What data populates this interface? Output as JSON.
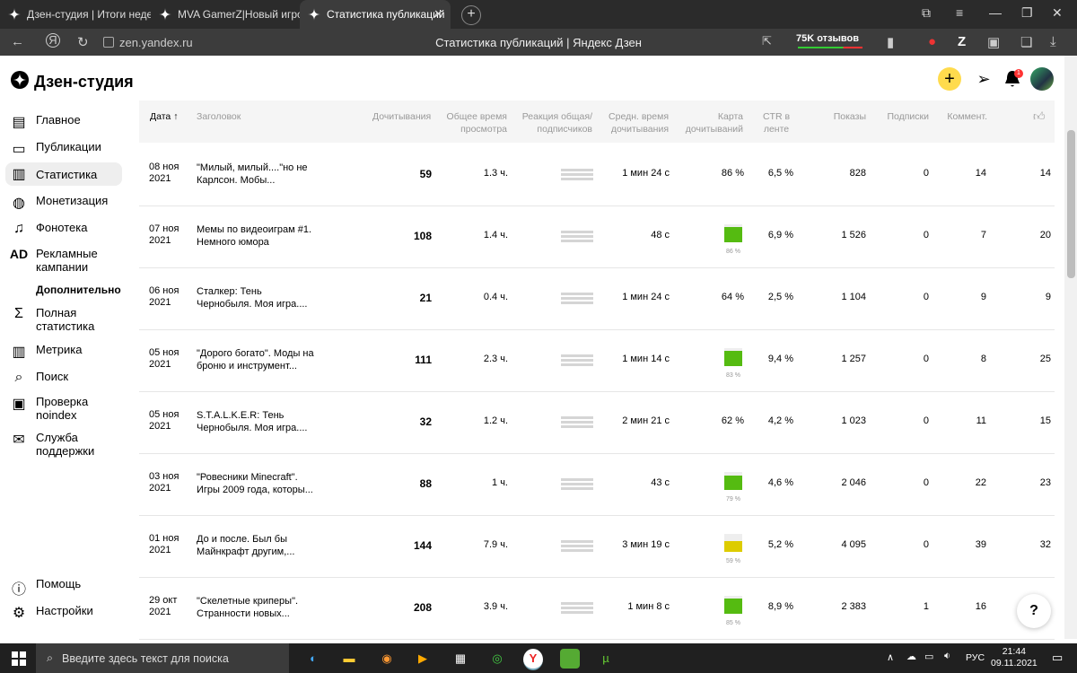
{
  "browser": {
    "tabs": [
      {
        "label": "Дзен-студия | Итоги неде",
        "icon": "zen-icon",
        "active": false
      },
      {
        "label": "MVA GamerZ|Новый игро",
        "icon": "zen-icon",
        "active": false
      },
      {
        "label": "Статистика публикаций",
        "icon": "zen-icon",
        "active": true
      }
    ],
    "url": "zen.yandex.ru",
    "page_title": "Статистика публикаций | Яндекс Дзен",
    "reviews_label": "75K отзывов"
  },
  "app": {
    "logo": "Дзен-студия"
  },
  "sidebar": {
    "items": [
      {
        "label": "Главное",
        "icon": "home-icon"
      },
      {
        "label": "Публикации",
        "icon": "publications-icon"
      },
      {
        "label": "Статистика",
        "icon": "statistics-icon",
        "active": true
      },
      {
        "label": "Монетизация",
        "icon": "monetization-icon"
      },
      {
        "label": "Фонотека",
        "icon": "music-icon"
      },
      {
        "label": "Рекламные кампании",
        "icon": "ad-icon",
        "glyph": "AD"
      }
    ],
    "section": "Дополнительно",
    "extra": [
      {
        "label": "Полная статистика",
        "icon": "sigma-icon"
      },
      {
        "label": "Метрика",
        "icon": "metrics-icon"
      },
      {
        "label": "Поиск",
        "icon": "search-icon"
      },
      {
        "label": "Проверка noindex",
        "icon": "noindex-icon"
      },
      {
        "label": "Служба поддержки",
        "icon": "mail-icon"
      }
    ],
    "bottom": [
      {
        "label": "Помощь",
        "icon": "help-icon"
      },
      {
        "label": "Настройки",
        "icon": "settings-icon"
      }
    ]
  },
  "table": {
    "headers": {
      "date": "Дата",
      "title": "Заголовок",
      "reads": "Дочитывания",
      "time": "Общее время просмотра",
      "reaction": "Реакция общая/ подписчиков",
      "avg": "Средн. время дочитывания",
      "map": "Карта дочитываний",
      "ctr": "CTR в ленте",
      "shows": "Показы",
      "subs": "Подписки",
      "comments": "Коммент."
    },
    "rows": [
      {
        "date": "08 ноя 2021",
        "title": "\"Милый, милый....\"но не Карлсон. Мобы...",
        "reads": "59",
        "time": "1.3 ч.",
        "avg": "1 мин 24 с",
        "map_pct": "86 %",
        "map_level": 0.86,
        "map_box": false,
        "ctr": "6,5 %",
        "shows": "828",
        "subs": "0",
        "comments": "14",
        "likes": "14"
      },
      {
        "date": "07 ноя 2021",
        "title": "Мемы по видеоиграм #1. Немного юмора",
        "reads": "108",
        "time": "1.4 ч.",
        "avg": "48 с",
        "map_pct": "86 %",
        "map_level": 0.86,
        "map_box": true,
        "ctr": "6,9 %",
        "shows": "1 526",
        "subs": "0",
        "comments": "7",
        "likes": "20"
      },
      {
        "date": "06 ноя 2021",
        "title": "Сталкер: Тень Чернобыля. Моя игра....",
        "reads": "21",
        "time": "0.4 ч.",
        "avg": "1 мин 24 с",
        "map_pct": "64 %",
        "map_level": 0.64,
        "map_box": false,
        "ctr": "2,5 %",
        "shows": "1 104",
        "subs": "0",
        "comments": "9",
        "likes": "9"
      },
      {
        "date": "05 ноя 2021",
        "title": "\"Дорого богато\". Моды на броню и инструмент...",
        "reads": "111",
        "time": "2.3 ч.",
        "avg": "1 мин 14 с",
        "map_pct": "83 %",
        "map_level": 0.83,
        "map_box": true,
        "ctr": "9,4 %",
        "shows": "1 257",
        "subs": "0",
        "comments": "8",
        "likes": "25"
      },
      {
        "date": "05 ноя 2021",
        "title": "S.T.A.L.K.E.R: Тень Чернобыля. Моя игра....",
        "reads": "32",
        "time": "1.2 ч.",
        "avg": "2 мин 21 с",
        "map_pct": "62 %",
        "map_level": 0.62,
        "map_box": false,
        "ctr": "4,2 %",
        "shows": "1 023",
        "subs": "0",
        "comments": "11",
        "likes": "15"
      },
      {
        "date": "03 ноя 2021",
        "title": "\"Ровесники Minecraft\". Игры 2009 года, которы...",
        "reads": "88",
        "time": "1 ч.",
        "avg": "43 с",
        "map_pct": "79 %",
        "map_level": 0.79,
        "map_box": true,
        "ctr": "4,6 %",
        "shows": "2 046",
        "subs": "0",
        "comments": "22",
        "likes": "23"
      },
      {
        "date": "01 ноя 2021",
        "title": "До и после. Был бы Майнкрафт другим,...",
        "reads": "144",
        "time": "7.9 ч.",
        "avg": "3 мин 19 с",
        "map_pct": "59 %",
        "map_level": 0.59,
        "map_box": true,
        "ctr": "5,2 %",
        "shows": "4 095",
        "subs": "0",
        "comments": "39",
        "likes": "32"
      },
      {
        "date": "29 окт 2021",
        "title": "\"Скелетные криперы\". Странности новых...",
        "reads": "208",
        "time": "3.9 ч.",
        "avg": "1 мин 8 с",
        "map_pct": "85 %",
        "map_level": 0.85,
        "map_box": true,
        "ctr": "8,9 %",
        "shows": "2 383",
        "subs": "1",
        "comments": "16",
        "likes": ""
      }
    ]
  },
  "help_button": "?",
  "taskbar": {
    "search_placeholder": "Введите здесь текст для поиска",
    "lang": "РУС",
    "time": "21:44",
    "date": "09.11.2021"
  },
  "colors": {
    "accent": "#ffdb4d",
    "map_green": "#55bb11",
    "map_yellow": "#ddcc00"
  }
}
